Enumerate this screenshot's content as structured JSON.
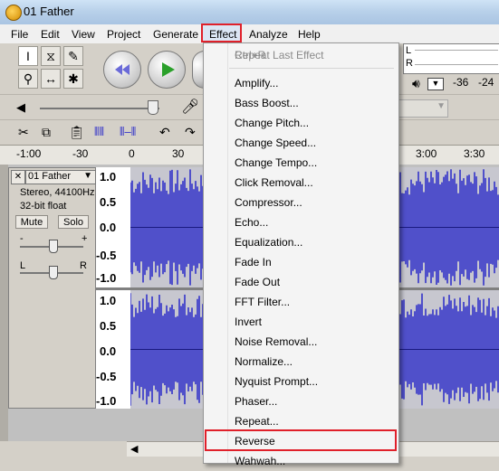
{
  "window": {
    "title": "01 Father",
    "icon": "audacity-app-icon"
  },
  "menubar": {
    "items": [
      "File",
      "Edit",
      "View",
      "Project",
      "Generate",
      "Effect",
      "Analyze",
      "Help"
    ],
    "highlighted": "Effect"
  },
  "meter": {
    "l": "L",
    "r": "R",
    "db_labels": [
      "-36",
      "-24"
    ]
  },
  "timeline": {
    "ticks": [
      "-1:00",
      "-30",
      "0",
      "30",
      "3:00",
      "3:30"
    ]
  },
  "track": {
    "name": "01 Father",
    "format1": "Stereo, 44100Hz",
    "format2": "32-bit float",
    "mute_label": "Mute",
    "solo_label": "Solo",
    "gain_minus": "-",
    "gain_plus": "+",
    "pan_left": "L",
    "pan_right": "R",
    "close_glyph": "✕",
    "scale_labels": [
      "1.0",
      "0.5",
      "0.0",
      "-0.5",
      "-1.0"
    ]
  },
  "effect_menu": {
    "items": [
      {
        "label": "Repeat Last Effect",
        "shortcut": "Ctrl+R",
        "disabled": true
      },
      {
        "label": "Amplify...",
        "disabled": false
      },
      {
        "label": "Bass Boost...",
        "disabled": false
      },
      {
        "label": "Change Pitch...",
        "disabled": false
      },
      {
        "label": "Change Speed...",
        "disabled": false
      },
      {
        "label": "Change Tempo...",
        "disabled": false
      },
      {
        "label": "Click Removal...",
        "disabled": false
      },
      {
        "label": "Compressor...",
        "disabled": false
      },
      {
        "label": "Echo...",
        "disabled": false
      },
      {
        "label": "Equalization...",
        "disabled": false
      },
      {
        "label": "Fade In",
        "disabled": false
      },
      {
        "label": "Fade Out",
        "disabled": false
      },
      {
        "label": "FFT Filter...",
        "disabled": false
      },
      {
        "label": "Invert",
        "disabled": false
      },
      {
        "label": "Noise Removal...",
        "disabled": false
      },
      {
        "label": "Normalize...",
        "disabled": false
      },
      {
        "label": "Nyquist Prompt...",
        "disabled": false
      },
      {
        "label": "Phaser...",
        "disabled": false
      },
      {
        "label": "Repeat...",
        "disabled": false
      },
      {
        "label": "Reverse",
        "disabled": false,
        "highlighted": true
      },
      {
        "label": "Wahwah...",
        "disabled": false
      }
    ]
  },
  "colors": {
    "highlight_red": "#e0202a",
    "waveform_blue": "#3232c8",
    "waveform_bg": "#c7c7cf"
  },
  "icons": [
    "selection-tool-icon",
    "envelope-tool-icon",
    "draw-tool-icon",
    "zoom-tool-icon",
    "timeshift-tool-icon",
    "multi-tool-icon",
    "skip-start-icon",
    "play-icon",
    "microphone-icon",
    "speaker-icon",
    "cut-icon",
    "copy-icon",
    "paste-icon",
    "trim-icon",
    "silence-icon",
    "undo-icon",
    "redo-icon"
  ]
}
